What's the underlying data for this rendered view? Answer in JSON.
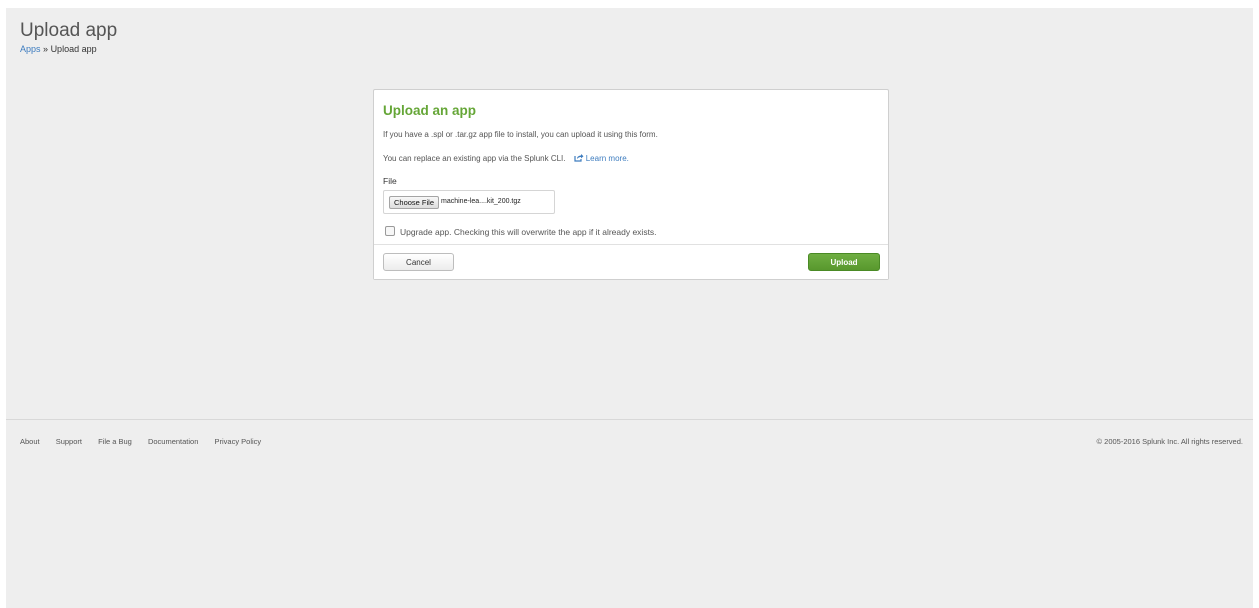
{
  "header": {
    "title": "Upload app",
    "breadcrumb": {
      "root_label": "Apps",
      "separator": "»",
      "current_label": "Upload app"
    }
  },
  "upload_form": {
    "title": "Upload an app",
    "intro_text": "If you have a .spl or .tar.gz app file to install, you can upload it using this form.",
    "cli_text": "You can replace an existing app via the Splunk CLI.",
    "learn_more_label": "Learn more.",
    "learn_more_icon": "external-link-icon",
    "file_label": "File",
    "choose_file_label": "Choose File",
    "selected_file_name": "machine-lea....kit_200.tgz",
    "upgrade_checked": false,
    "upgrade_label": "Upgrade app. Checking this will overwrite the app if it already exists.",
    "cancel_label": "Cancel",
    "upload_label": "Upload"
  },
  "footer": {
    "links": [
      "About",
      "Support",
      "File a Bug",
      "Documentation",
      "Privacy Policy"
    ],
    "copyright": "© 2005-2016 Splunk Inc. All rights reserved."
  },
  "colors": {
    "page_background": "#eeeeee",
    "title_green": "#65a637",
    "link_blue": "#3d7cbf",
    "upload_button_green": "#5a9a2f"
  }
}
